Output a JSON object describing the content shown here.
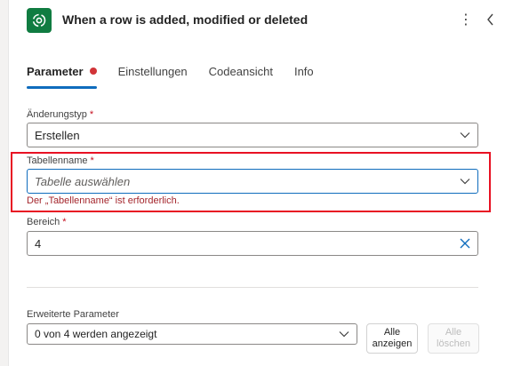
{
  "header": {
    "title": "When a row is added, modified or deleted",
    "more_icon": "⋮"
  },
  "tabs": [
    {
      "label": "Parameter",
      "active": true,
      "has_error": true
    },
    {
      "label": "Einstellungen"
    },
    {
      "label": "Codeansicht"
    },
    {
      "label": "Info"
    }
  ],
  "form": {
    "change_type": {
      "label": "Änderungstyp",
      "required_mark": "*",
      "value": "Erstellen"
    },
    "table_name": {
      "label": "Tabellenname",
      "required_mark": "*",
      "placeholder": "Tabelle auswählen",
      "error": "Der „Tabellenname“ ist erforderlich."
    },
    "scope": {
      "label": "Bereich",
      "required_mark": "*",
      "value": "4"
    }
  },
  "advanced": {
    "label": "Erweiterte Parameter",
    "dropdown_value": "0 von 4 werden angezeigt",
    "show_all_line1": "Alle",
    "show_all_line2": "anzeigen",
    "clear_all_line1": "Alle",
    "clear_all_line2": "löschen"
  },
  "colors": {
    "app_icon_bg": "#107c41",
    "accent": "#0f6cbd",
    "error": "#a4262c",
    "highlight": "#e81123"
  }
}
